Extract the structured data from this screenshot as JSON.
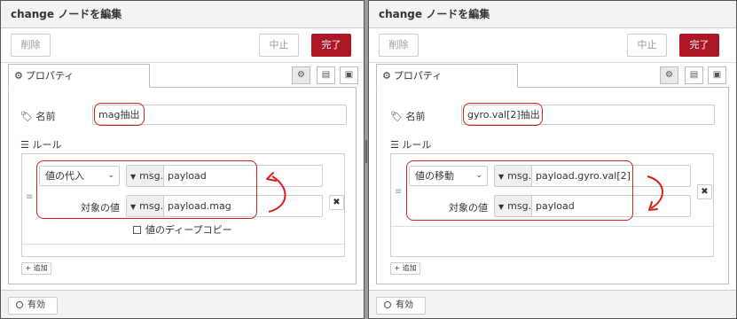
{
  "left": {
    "tray_title": "change ノードを編集",
    "delete_label": "削除",
    "cancel_label": "中止",
    "done_label": "完了",
    "tab_properties_label": "プロパティ",
    "name_label": "名前",
    "name_value": "mag抽出",
    "rules_label": "ルール",
    "rule": {
      "action_value": "値の代入",
      "target_prefix": "msg.",
      "target_value": "payload",
      "source_label": "対象の値",
      "source_prefix": "msg.",
      "source_value": "payload.mag",
      "deep_copy_label": "値のディープコピー"
    },
    "add_label": "追加",
    "enable_label": "有効"
  },
  "right": {
    "tray_title": "change ノードを編集",
    "delete_label": "削除",
    "cancel_label": "中止",
    "done_label": "完了",
    "tab_properties_label": "プロパティ",
    "name_label": "名前",
    "name_value": "gyro.val[2]抽出",
    "rules_label": "ルール",
    "rule": {
      "action_value": "値の移動",
      "target_prefix": "msg.",
      "target_value": "payload.gyro.val[2]",
      "source_label": "対象の値",
      "source_prefix": "msg.",
      "source_value": "payload"
    },
    "add_label": "追加",
    "enable_label": "有効"
  },
  "colors": {
    "done_button": "#ad1625",
    "annotation_red": "#d42020"
  },
  "icons": [
    "gear-icon",
    "tag-icon",
    "list-icon",
    "description-icon",
    "appearance-icon",
    "chevron-down-icon",
    "caret-down-icon",
    "close-icon",
    "drag-handle-icon",
    "plus-icon",
    "circle-icon"
  ]
}
